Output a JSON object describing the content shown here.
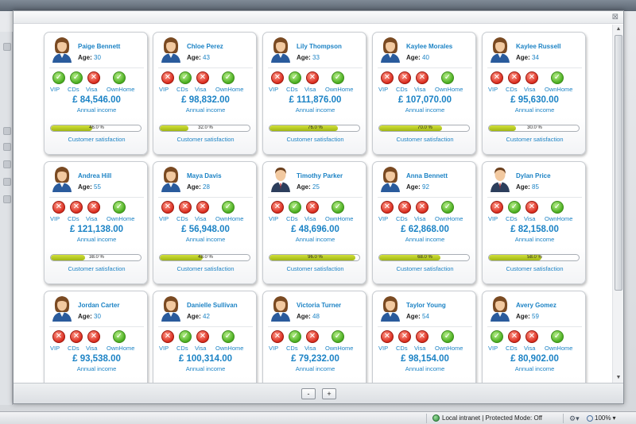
{
  "flag_labels": [
    "VIP",
    "CDs",
    "Visa",
    "OwnHome"
  ],
  "income_label": "Annual income",
  "satisfaction_label": "Customer satisfaction",
  "age_label": "Age:",
  "pager": {
    "prev": "-",
    "next": "+"
  },
  "statusbar": {
    "zone": "Local intranet | Protected Mode: Off",
    "zoom": "100%"
  },
  "colors": {
    "accent": "#1c83c5",
    "yes": "#49ad1e",
    "no": "#d92b1e",
    "bar": "#b4c820"
  },
  "customers": [
    {
      "name": "Paige Bennett",
      "age": "30",
      "gender": "f",
      "flags": [
        1,
        1,
        0,
        1
      ],
      "income": "£ 84,546.00",
      "satisfaction": 0.46,
      "satisfaction_text": "46.0 %"
    },
    {
      "name": "Chloe Perez",
      "age": "43",
      "gender": "f",
      "flags": [
        0,
        1,
        0,
        1
      ],
      "income": "£ 98,832.00",
      "satisfaction": 0.32,
      "satisfaction_text": "32.0 %"
    },
    {
      "name": "Lily Thompson",
      "age": "33",
      "gender": "f",
      "flags": [
        0,
        1,
        0,
        1
      ],
      "income": "£ 111,876.00",
      "satisfaction": 0.76,
      "satisfaction_text": "76.0 %"
    },
    {
      "name": "Kaylee Morales",
      "age": "40",
      "gender": "f",
      "flags": [
        0,
        0,
        0,
        1
      ],
      "income": "£ 107,070.00",
      "satisfaction": 0.7,
      "satisfaction_text": "70.0 %"
    },
    {
      "name": "Kaylee Russell",
      "age": "34",
      "gender": "f",
      "flags": [
        0,
        0,
        0,
        1
      ],
      "income": "£ 95,630.00",
      "satisfaction": 0.3,
      "satisfaction_text": "30.0 %"
    },
    {
      "name": "Andrea Hill",
      "age": "55",
      "gender": "f",
      "flags": [
        0,
        0,
        0,
        1
      ],
      "income": "£ 121,138.00",
      "satisfaction": 0.38,
      "satisfaction_text": "38.0 %"
    },
    {
      "name": "Maya Davis",
      "age": "28",
      "gender": "f",
      "flags": [
        0,
        0,
        0,
        1
      ],
      "income": "£ 56,948.00",
      "satisfaction": 0.48,
      "satisfaction_text": "48.0 %"
    },
    {
      "name": "Timothy Parker",
      "age": "25",
      "gender": "m",
      "flags": [
        0,
        1,
        0,
        1
      ],
      "income": "£ 48,696.00",
      "satisfaction": 0.96,
      "satisfaction_text": "96.0 %"
    },
    {
      "name": "Anna Bennett",
      "age": "92",
      "gender": "f",
      "flags": [
        0,
        0,
        0,
        1
      ],
      "income": "£ 62,868.00",
      "satisfaction": 0.68,
      "satisfaction_text": "68.0 %"
    },
    {
      "name": "Dylan Price",
      "age": "85",
      "gender": "m",
      "flags": [
        0,
        1,
        0,
        1
      ],
      "income": "£ 82,158.00",
      "satisfaction": 0.58,
      "satisfaction_text": "58.0 %"
    },
    {
      "name": "Jordan Carter",
      "age": "30",
      "gender": "f",
      "flags": [
        0,
        0,
        0,
        1
      ],
      "income": "£ 93,538.00",
      "satisfaction": null,
      "satisfaction_text": ""
    },
    {
      "name": "Danielle Sullivan",
      "age": "42",
      "gender": "f",
      "flags": [
        0,
        1,
        0,
        1
      ],
      "income": "£ 100,314.00",
      "satisfaction": null,
      "satisfaction_text": ""
    },
    {
      "name": "Victoria Turner",
      "age": "48",
      "gender": "f",
      "flags": [
        0,
        1,
        0,
        1
      ],
      "income": "£ 79,232.00",
      "satisfaction": null,
      "satisfaction_text": ""
    },
    {
      "name": "Taylor Young",
      "age": "54",
      "gender": "f",
      "flags": [
        0,
        0,
        0,
        1
      ],
      "income": "£ 98,154.00",
      "satisfaction": null,
      "satisfaction_text": ""
    },
    {
      "name": "Avery Gomez",
      "age": "59",
      "gender": "f",
      "flags": [
        1,
        0,
        0,
        1
      ],
      "income": "£ 80,902.00",
      "satisfaction": null,
      "satisfaction_text": ""
    }
  ]
}
